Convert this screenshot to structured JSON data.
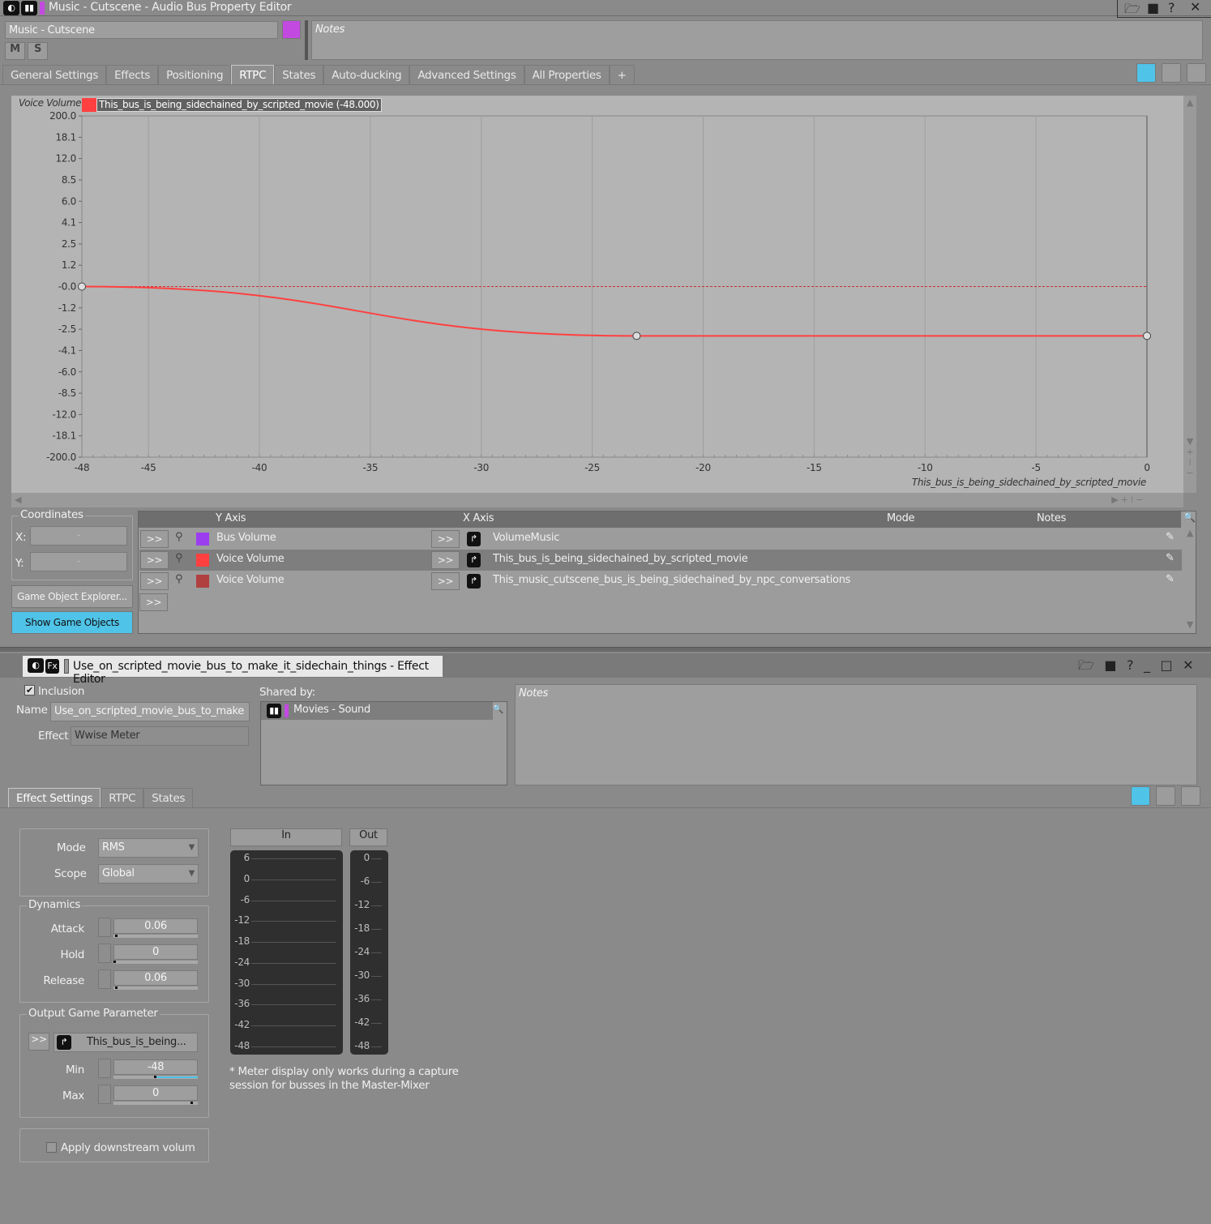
{
  "window": {
    "title": "Music - Cutscene - Audio Bus Property Editor",
    "header_icons": [
      "folder-open-icon",
      "save-icon",
      "help-icon",
      "close-icon"
    ]
  },
  "bus": {
    "name": "Music - Cutscene",
    "color": "#c24ae0",
    "notes_placeholder": "Notes",
    "mute_label": "M",
    "solo_label": "S"
  },
  "tabs": [
    "General Settings",
    "Effects",
    "Positioning",
    "RTPC",
    "States",
    "Auto-ducking",
    "Advanced Settings",
    "All Properties",
    "+"
  ],
  "active_tab": "RTPC",
  "graph_legend": {
    "y_label": "Voice Volume",
    "curve_label": "This_bus_is_being_sidechained_by_scripted_movie (-48.000)",
    "color": "#ff4040"
  },
  "chart_data": {
    "type": "line",
    "ylabel": "Voice Volume",
    "xlabel": "This_bus_is_being_sidechained_by_scripted_movie",
    "xlim": [
      -48,
      0
    ],
    "x_ticks": [
      "-48",
      "-45",
      "-40",
      "-35",
      "-30",
      "-25",
      "-20",
      "-15",
      "-10",
      "-5",
      "0"
    ],
    "y_ticks": [
      "200.0",
      "18.1",
      "12.0",
      "8.5",
      "6.0",
      "4.1",
      "2.5",
      "1.2",
      "-0.0",
      "-1.2",
      "-2.5",
      "-4.1",
      "-6.0",
      "-8.5",
      "-12.0",
      "-18.1",
      "-200.0"
    ],
    "grid": true,
    "series": [
      {
        "name": "This_bus_is_being_sidechained_by_scripted_movie",
        "color": "#ff4040",
        "points": [
          [
            -48,
            0
          ],
          [
            -23,
            -3.0
          ],
          [
            0,
            -3.0
          ]
        ]
      }
    ]
  },
  "coordinates": {
    "title": "Coordinates",
    "x_label": "X:",
    "y_label": "Y:",
    "x_value": "-",
    "y_value": "-"
  },
  "buttons": {
    "game_object_explorer": "Game Object Explorer...",
    "show_game_objects": "Show Game Objects"
  },
  "rtpc_table": {
    "columns": [
      "Y Axis",
      "X Axis",
      "Mode",
      "Notes"
    ],
    "rows": [
      {
        "y": "Bus Volume",
        "color": "#9b3ef0",
        "x": "VolumeMusic",
        "btn": ">>"
      },
      {
        "y": "Voice Volume",
        "color": "#ff4040",
        "x": "This_bus_is_being_sidechained_by_scripted_movie",
        "btn": ">>"
      },
      {
        "y": "Voice Volume",
        "color": "#b04040",
        "x": "This_music_cutscene_bus_is_being_sidechained_by_npc_conversations",
        "btn": ">>"
      }
    ],
    "add_btn": ">>"
  },
  "effect_editor": {
    "title": "Use_on_scripted_movie_bus_to_make_it_sidechain_things - Effect Editor",
    "inclusion_label": "Inclusion",
    "inclusion_checked": true,
    "name_label": "Name",
    "name_value": "Use_on_scripted_movie_bus_to_make",
    "effect_label": "Effect",
    "effect_value": "Wwise Meter",
    "shared_by_label": "Shared by:",
    "shared_by": [
      "Movies - Sound"
    ],
    "notes_placeholder": "Notes",
    "tabs": [
      "Effect Settings",
      "RTPC",
      "States"
    ],
    "mode_label": "Mode",
    "mode_value": "RMS",
    "scope_label": "Scope",
    "scope_value": "Global",
    "dynamics_title": "Dynamics",
    "attack_label": "Attack",
    "attack_value": "0.06",
    "hold_label": "Hold",
    "hold_value": "0",
    "release_label": "Release",
    "release_value": "0.06",
    "ogp_title": "Output Game Parameter",
    "ogp_btn": ">>",
    "ogp_value": "This_bus_is_being...",
    "min_label": "Min",
    "min_value": "-48",
    "max_label": "Max",
    "max_value": "0",
    "apply_label": "Apply downstream volum",
    "apply_checked": false,
    "meter_in_label": "In",
    "meter_out_label": "Out",
    "meter_in_ticks": [
      "6",
      "0",
      "-6",
      "-12",
      "-18",
      "-24",
      "-30",
      "-36",
      "-42",
      "-48"
    ],
    "meter_out_ticks": [
      "0",
      "-6",
      "-12",
      "-18",
      "-24",
      "-30",
      "-36",
      "-42",
      "-48"
    ],
    "meter_note_1": "* Meter display only works during a capture",
    "meter_note_2": "session for busses in the Master-Mixer",
    "accent": "#4fc3e8"
  }
}
